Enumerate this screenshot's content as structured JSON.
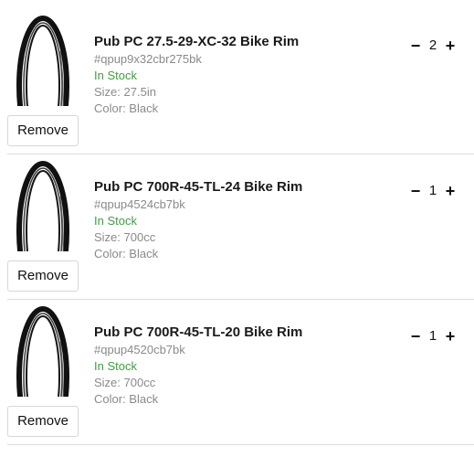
{
  "cart": {
    "remove_label": "Remove",
    "minus_symbol": "−",
    "plus_symbol": "+",
    "items": [
      {
        "title": "Pub PC 27.5-29-XC-32 Bike Rim",
        "sku": "#qpup9x32cbr275bk",
        "stock": "In Stock",
        "size": "Size: 27.5in",
        "color": "Color: Black",
        "quantity": "2",
        "image_icon": "bike-rim-icon"
      },
      {
        "title": "Pub PC 700R-45-TL-24 Bike Rim",
        "sku": "#qpup4524cb7bk",
        "stock": "In Stock",
        "size": "Size: 700cc",
        "color": "Color: Black",
        "quantity": "1",
        "image_icon": "bike-rim-icon"
      },
      {
        "title": "Pub PC 700R-45-TL-20 Bike Rim",
        "sku": "#qpup4520cb7bk",
        "stock": "In Stock",
        "size": "Size: 700cc",
        "color": "Color: Black",
        "quantity": "1",
        "image_icon": "bike-rim-icon"
      }
    ]
  },
  "colors": {
    "in_stock": "#3f9e3f",
    "muted_text": "#8a8a8a",
    "divider": "#dcdcdc"
  }
}
